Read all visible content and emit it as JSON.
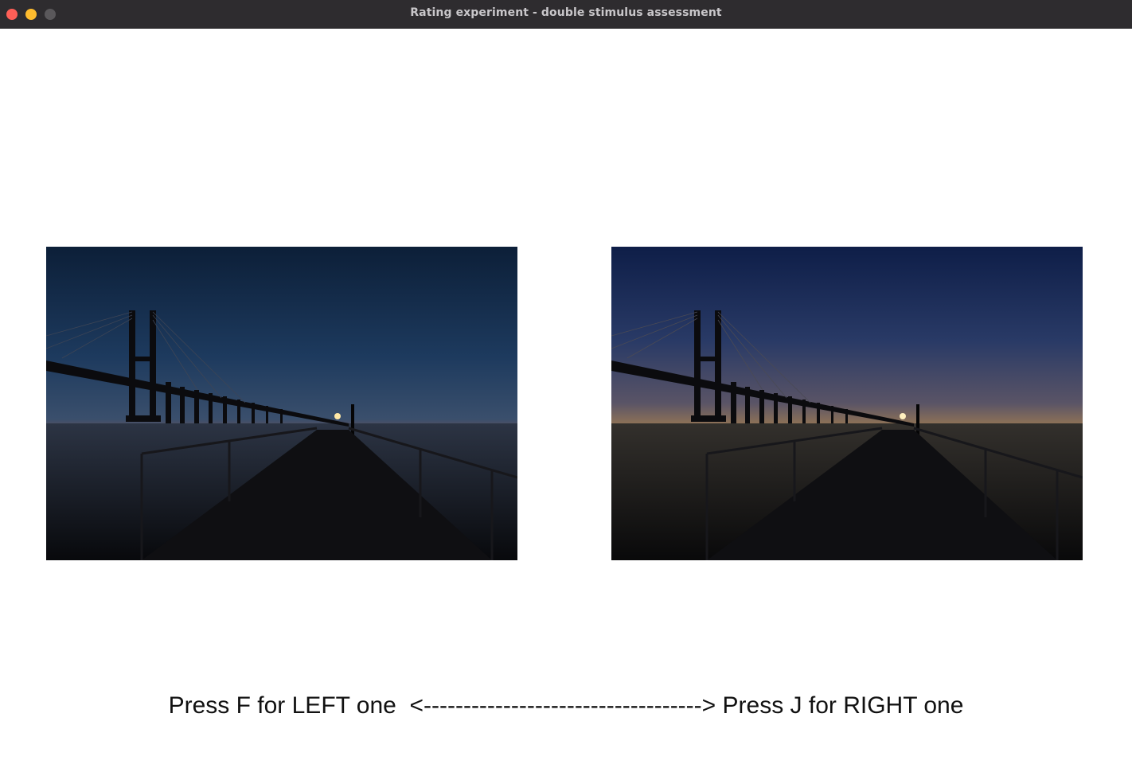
{
  "window": {
    "title": "Rating experiment - double stimulus assessment"
  },
  "stimuli": {
    "left": {
      "icon": "bridge-sunset-photo",
      "tone": "red-orange horizon"
    },
    "right": {
      "icon": "bridge-sunset-photo",
      "tone": "golden horizon"
    }
  },
  "instructions": {
    "text": "Press F for LEFT one  <-----------------------------------> Press J for RIGHT one"
  }
}
